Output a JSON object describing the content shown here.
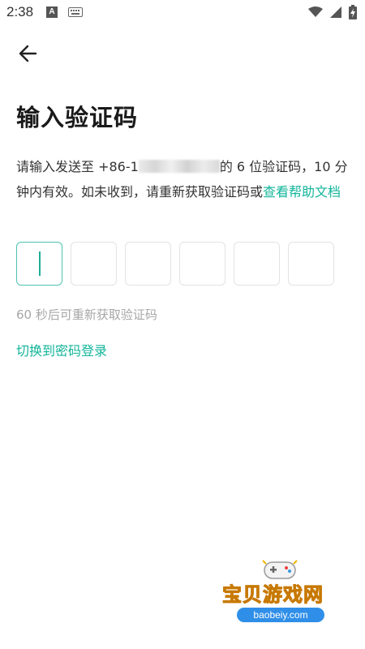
{
  "status_bar": {
    "time": "2:38",
    "notification_icons": [
      "a-notification-icon",
      "keyboard-icon"
    ],
    "right_icons": [
      "wifi-icon",
      "signal-icon",
      "battery-charging-icon"
    ]
  },
  "header": {
    "back_icon": "arrow-left-icon"
  },
  "title": "输入验证码",
  "description": {
    "prefix": "请输入发送至 +86-1",
    "masked_phone": "",
    "suffix": "的 6 位验证码，10 分钟内有效。如未收到，请重新获取验证码或",
    "help_link": "查看帮助文档"
  },
  "code_input": {
    "length": 6,
    "digits": [
      "",
      "",
      "",
      "",
      "",
      ""
    ],
    "active_index": 0
  },
  "countdown_text": "60 秒后可重新获取验证码",
  "switch_link": "切换到密码登录",
  "watermark": {
    "title": "宝贝游戏网",
    "url": "baobeiy.com"
  },
  "colors": {
    "accent": "#12b59a",
    "box_border": "#e3e3e3",
    "muted_text": "#a7a7a7"
  }
}
